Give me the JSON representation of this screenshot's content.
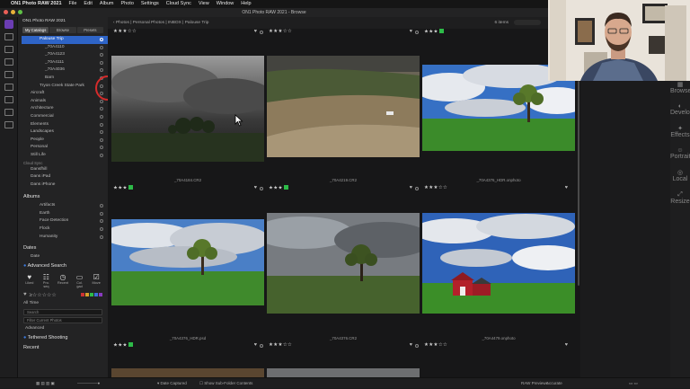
{
  "menubar": {
    "app": "ON1 Photo RAW 2021",
    "items": [
      "File",
      "Edit",
      "Album",
      "Photo",
      "Settings",
      "Cloud Sync",
      "View",
      "Window",
      "Help"
    ]
  },
  "window": {
    "title": "ON1 Photo RAW 2021 - Browse"
  },
  "sidebar": {
    "app_title": "ON1 Photo RAW 2021",
    "tabs": [
      "My Catalogs",
      "Browse",
      "Presets"
    ],
    "folders": [
      {
        "label": "Palouse Trip",
        "selected": true
      },
      {
        "label": "_70A4110",
        "selected": false
      },
      {
        "label": "_70A4123",
        "selected": false
      },
      {
        "label": "_70A4111",
        "selected": false
      },
      {
        "label": "_70A4036",
        "selected": false
      },
      {
        "label": "Barn",
        "selected": false
      },
      {
        "label": "Tryon Creek State Park",
        "selected": false
      },
      {
        "label": "Aircraft",
        "selected": false
      },
      {
        "label": "Animals",
        "selected": false
      },
      {
        "label": "Architecture",
        "selected": false
      },
      {
        "label": "Commercial",
        "selected": false
      },
      {
        "label": "Elements",
        "selected": false
      },
      {
        "label": "Landscapes",
        "selected": false
      },
      {
        "label": "People",
        "selected": false
      },
      {
        "label": "Personal",
        "selected": false
      },
      {
        "label": "Still Life",
        "selected": false
      }
    ],
    "cloud_sync_label": "Cloud Sync",
    "cloud_items": [
      "Dansfhill",
      "Dans iPad",
      "Dans iPhone"
    ],
    "albums_label": "Albums",
    "albums": [
      "Artifacts",
      "Earth",
      "Face Detection",
      "Flock",
      "Humanity"
    ],
    "dates_label": "Dates",
    "dates_item": "Date",
    "advanced_search_label": "Advanced Search",
    "smart_filters": [
      "Liked",
      "Pro. seq",
      "Recent",
      "Col. gad",
      "Move"
    ],
    "all_time_label": "All Time",
    "search_placeholder": "Search",
    "filter_label": "Filter Current Photos",
    "advanced_label": "Advanced",
    "tethered_label": "Tethered Shooting",
    "recent_label": "Recent"
  },
  "pathbar": {
    "path": "Photos | Personal Photos | INBOX | Palouse Trip",
    "count": "6 items"
  },
  "photos": [
    {
      "name": "_70A4184.CR2",
      "stars": 3,
      "green": true
    },
    {
      "name": "_70A4219.CR2",
      "stars": 3,
      "green": true
    },
    {
      "name": "_70A4376_HDR.onphoto",
      "stars": 3,
      "green": false
    },
    {
      "name": "_70A4376_HDR.psd",
      "stars": 3,
      "green": true
    },
    {
      "name": "_70A4376.CR2",
      "stars": 3,
      "green": false
    },
    {
      "name": "_70A4479.onphoto",
      "stars": 3,
      "green": false
    }
  ],
  "statusbar": {
    "sort_label": "Date Captured",
    "subfolder_label": "Show Sub-Folder Contents",
    "preview_label": "RAW Previews",
    "preview_value": "Accurate"
  },
  "right_rail": [
    "Browse",
    "Develop",
    "Effects",
    "Portrait",
    "Local",
    "Resize"
  ],
  "colors": {
    "accent": "#2e64c7",
    "green_label": "#2dbb48",
    "annotation": "#d42b2b"
  }
}
